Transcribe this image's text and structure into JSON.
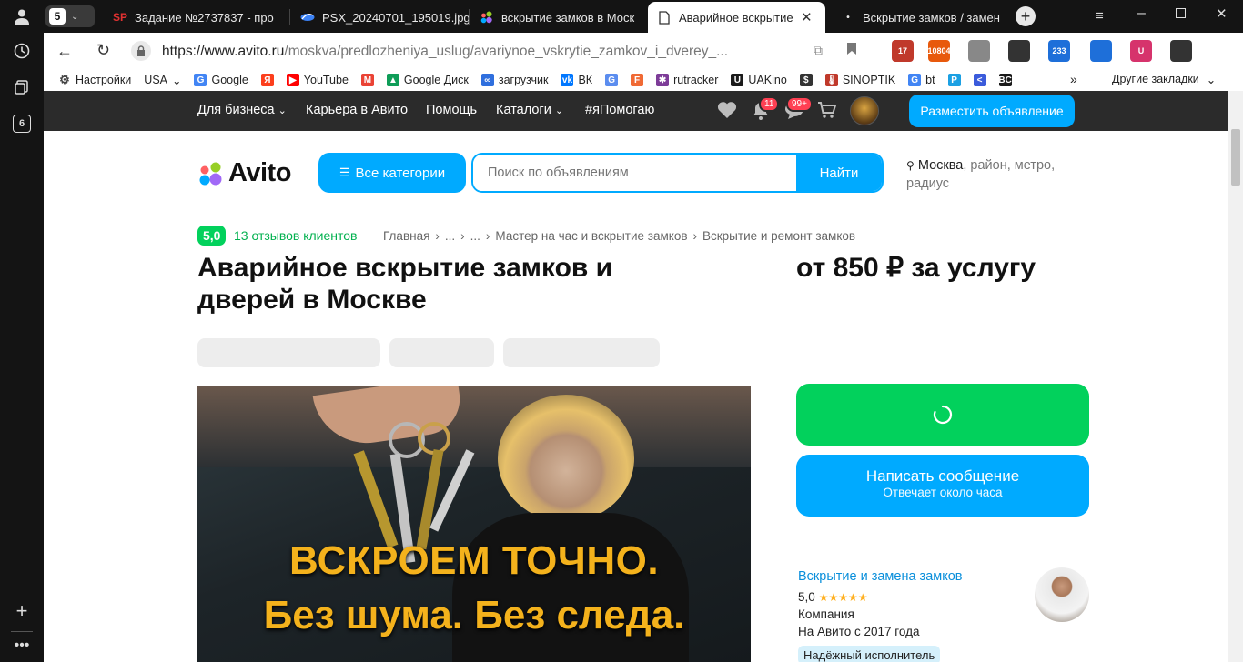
{
  "browser": {
    "sidebar": {
      "tab_count": "6"
    },
    "tab_group_count": "5",
    "tabs": [
      {
        "title": "Задание №2737837 - про",
        "favicon": "SP"
      },
      {
        "title": "PSX_20240701_195019.jpg",
        "favicon": "image-icon"
      },
      {
        "title": "вскрытие замков в Моск",
        "favicon": "avito-icon"
      },
      {
        "title": "Аварийное вскрытие з",
        "favicon": "document-icon"
      },
      {
        "title": "Вскрытие замков / замен",
        "favicon": "dot"
      }
    ],
    "address": {
      "protocol_host": "https://www.avito.ru",
      "path": "/moskva/predlozheniya_uslug/avariynoe_vskrytie_zamkov_i_dverey_..."
    },
    "extensions": [
      {
        "name": "calendar-ext",
        "badge": "17",
        "color": "#c0392b"
      },
      {
        "name": "clock-ext",
        "badge": "10804",
        "color": "#e8590c"
      },
      {
        "name": "briefcase-ext",
        "badge": "",
        "color": "#888888"
      },
      {
        "name": "reader-ext",
        "badge": "",
        "color": "#333333"
      },
      {
        "name": "calendar2-ext",
        "badge": "233",
        "color": "#1e6fd9"
      },
      {
        "name": "diamond-ext",
        "badge": "",
        "color": "#1e6fd9"
      },
      {
        "name": "shield-ext",
        "badge": "U",
        "color": "#d6336c"
      },
      {
        "name": "puzzle-ext",
        "badge": "",
        "color": "#333333"
      }
    ],
    "bookmarks": [
      {
        "label": "Настройки",
        "icon": "gear-icon",
        "color": "#444444"
      },
      {
        "label": "USA",
        "icon": "",
        "color": ""
      },
      {
        "label": "Google",
        "icon": "G",
        "color": "#4285f4"
      },
      {
        "label": "",
        "icon": "Я",
        "color": "#fc3f1d"
      },
      {
        "label": "YouTube",
        "icon": "▶",
        "color": "#ff0000"
      },
      {
        "label": "",
        "icon": "M",
        "color": "#ea4335"
      },
      {
        "label": "Google Диск",
        "icon": "▲",
        "color": "#0f9d58"
      },
      {
        "label": "загрузчик",
        "icon": "∞",
        "color": "#2f6fde"
      },
      {
        "label": "ВК",
        "icon": "vk",
        "color": "#0077ff"
      },
      {
        "label": "",
        "icon": "G",
        "color": "#5b8def"
      },
      {
        "label": "",
        "icon": "F",
        "color": "#f06a35"
      },
      {
        "label": "rutracker",
        "icon": "✱",
        "color": "#7d3c98"
      },
      {
        "label": "UAKino",
        "icon": "U",
        "color": "#1a1a1a"
      },
      {
        "label": "",
        "icon": "$",
        "color": "#333333"
      },
      {
        "label": "SINOPTIK",
        "icon": "🌡",
        "color": "#c0392b"
      },
      {
        "label": "bt",
        "icon": "G",
        "color": "#4285f4"
      },
      {
        "label": "",
        "icon": "P",
        "color": "#1ca0e3"
      },
      {
        "label": "",
        "icon": "<",
        "color": "#3b5bdb"
      },
      {
        "label": "",
        "icon": "BC",
        "color": "#1a1a1a"
      }
    ],
    "bookmarks_more": "»",
    "other_bookmarks": "Другие закладки"
  },
  "avito": {
    "topnav": {
      "items": [
        "Для бизнеса",
        "Карьера в Авито",
        "Помощь",
        "Каталоги",
        "#яПомогаю"
      ],
      "notif_badge": "11",
      "msg_badge": "99+",
      "post_button": "Разместить объявление"
    },
    "logo_text": "Avito",
    "categories_button": "Все категории",
    "search": {
      "placeholder": "Поиск по объявлениям",
      "button": "Найти"
    },
    "location": {
      "city": "Москва",
      "rest": ", район, метро, радиус"
    },
    "rating": {
      "score": "5,0",
      "reviews": "13 отзывов клиентов"
    },
    "breadcrumbs": [
      "Главная",
      "...",
      "...",
      "Мастер на час и вскрытие замков",
      "Вскрытие и ремонт замков"
    ],
    "title": "Аварийное вскрытие замков и дверей в Москве",
    "price": "от 850 ₽ за услугу",
    "ad_image": {
      "line1": "ВСКРОЕМ ТОЧНО.",
      "line2": "Без шума. Без следа."
    },
    "message_button": {
      "label": "Написать сообщение",
      "sub": "Отвечает около часа"
    },
    "seller": {
      "name": "Вскрытие и замена замков",
      "rating": "5,0",
      "stars": "★★★★★",
      "type": "Компания",
      "since": "На Авито с 2017 года",
      "badge": "Надёжный исполнитель"
    },
    "colors": {
      "accent": "#00aaff",
      "green": "#02d15c",
      "dark": "#2b2b2b"
    }
  }
}
